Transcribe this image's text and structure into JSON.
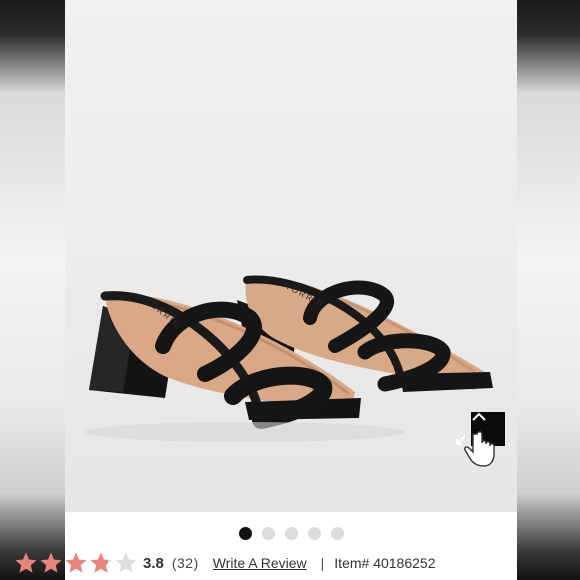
{
  "product": {
    "image_alt": "Black square-toe double strap block heel mule sandals",
    "brand_imprint": "TORRID"
  },
  "gallery": {
    "slide_count": 5,
    "active_index": 0
  },
  "rating": {
    "value": 3.8,
    "value_text": "3.8",
    "count_text": "(32)",
    "star_color": "#e8857a",
    "empty_color": "#dddddd"
  },
  "actions": {
    "write_review_label": "Write A Review"
  },
  "item": {
    "separator": "|",
    "label": "Item# 40186252"
  },
  "icons": {
    "up_button": "chevron-up-icon",
    "expand": "expand-icon",
    "cursor": "hand-pointer-icon"
  }
}
